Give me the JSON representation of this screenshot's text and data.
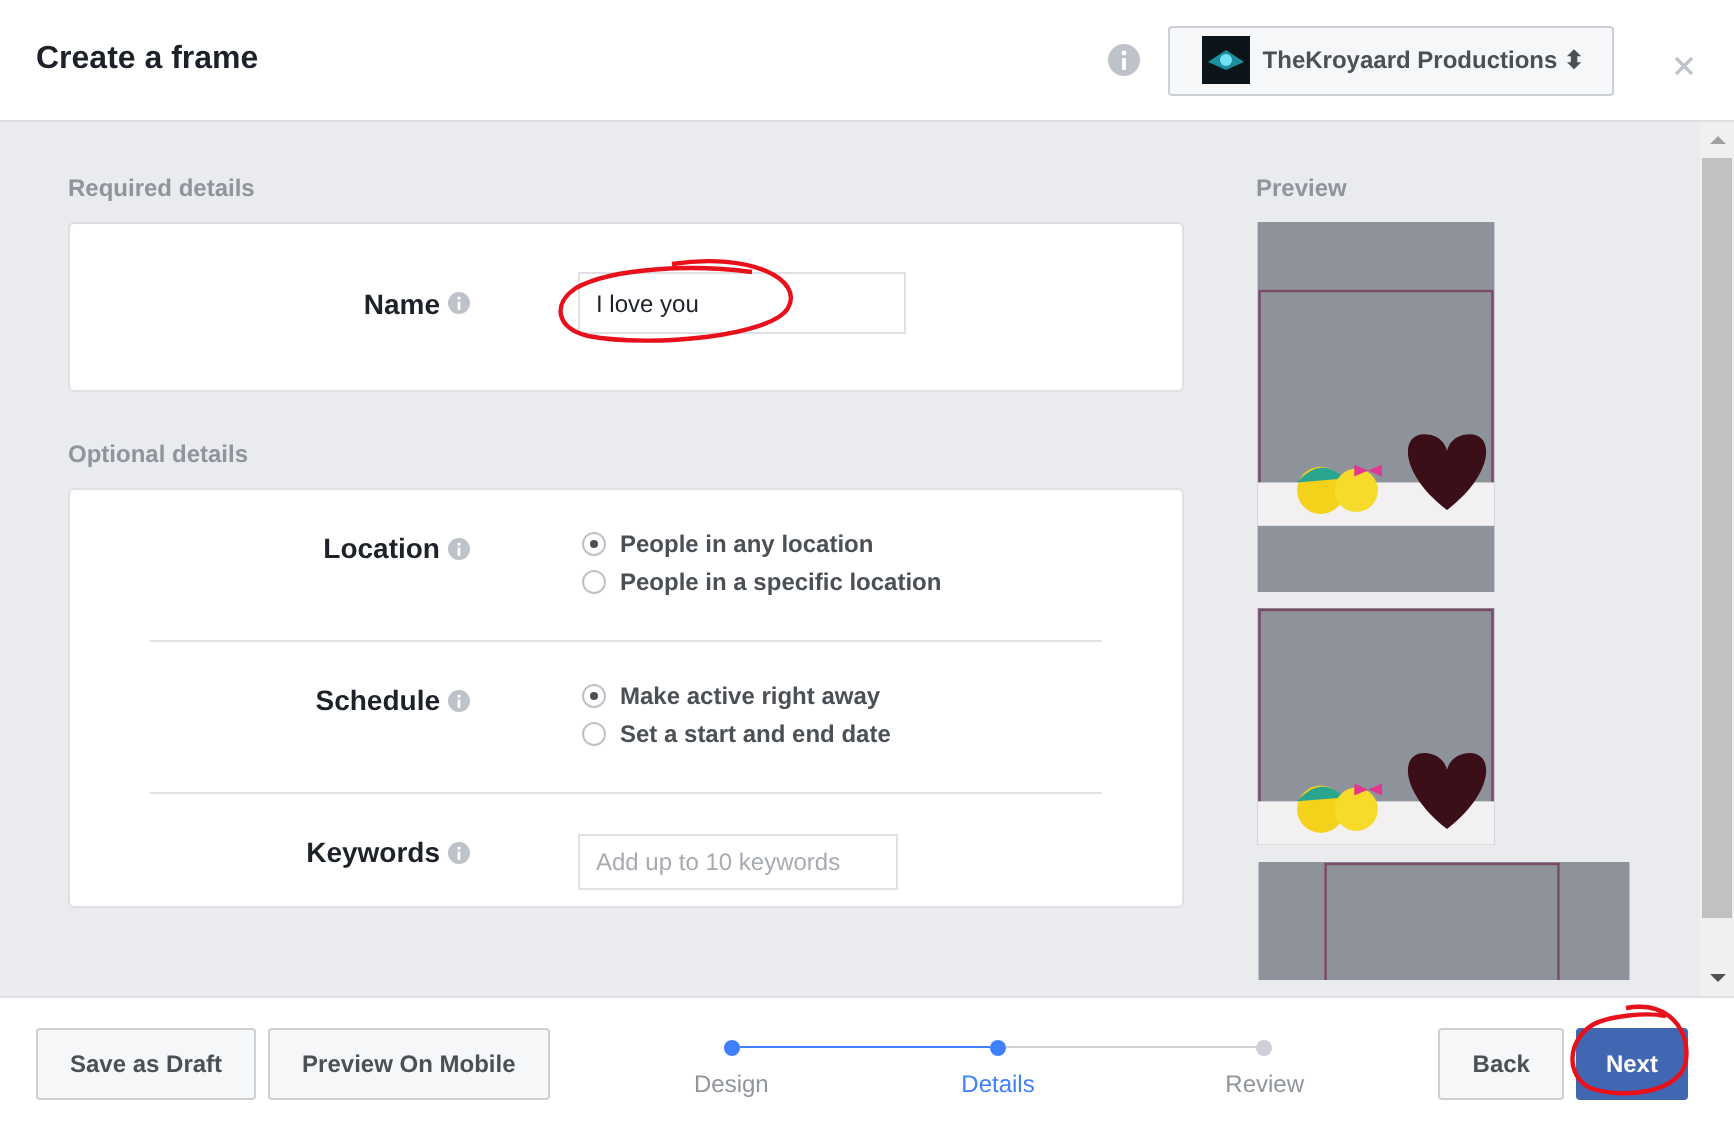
{
  "dialog": {
    "title": "Create a frame",
    "page_selector": {
      "label": "TheKroyaard Productions",
      "caret": "⬍"
    }
  },
  "required": {
    "heading": "Required details",
    "name_label": "Name",
    "name_value": "I love you"
  },
  "optional": {
    "heading": "Optional details",
    "rows": [
      {
        "kind": "radio",
        "label": "Location",
        "options": [
          {
            "label": "People in any location",
            "selected": true
          },
          {
            "label": "People in a specific location",
            "selected": false
          }
        ]
      },
      {
        "kind": "radio",
        "label": "Schedule",
        "options": [
          {
            "label": "Make active right away",
            "selected": true
          },
          {
            "label": "Set a start and end date",
            "selected": false
          }
        ]
      },
      {
        "kind": "input",
        "label": "Keywords",
        "placeholder": "Add up to 10 keywords"
      }
    ]
  },
  "preview": {
    "heading": "Preview"
  },
  "footer": {
    "buttons": [
      "Save as Draft",
      "Preview On Mobile"
    ],
    "steps": [
      {
        "label": "Design",
        "completed": true,
        "selected": false
      },
      {
        "label": "Details",
        "completed": true,
        "selected": true
      },
      {
        "label": "Review",
        "completed": false,
        "selected": false
      }
    ],
    "back": "Back",
    "next": "Next"
  }
}
